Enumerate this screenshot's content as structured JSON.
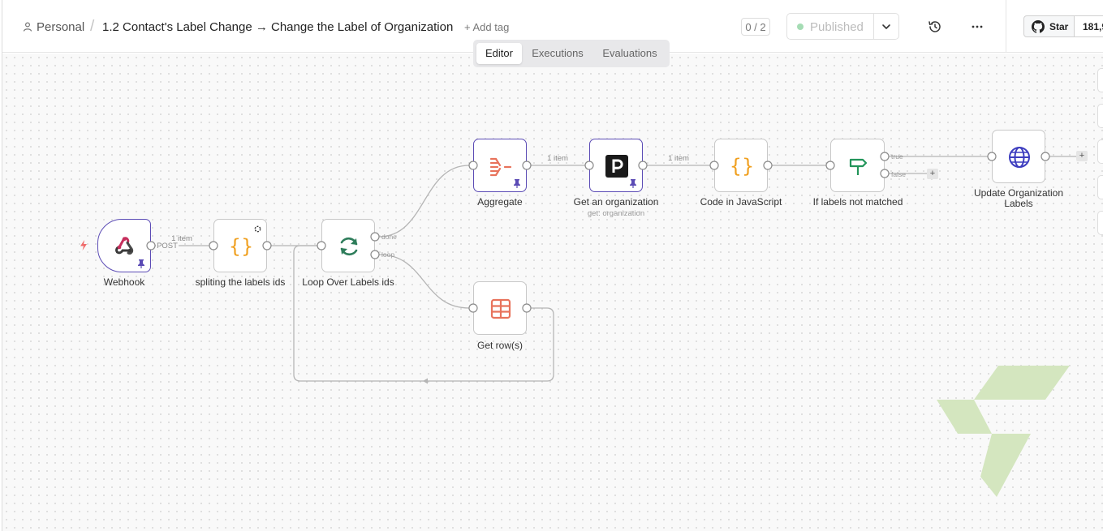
{
  "header": {
    "project": "Personal",
    "separator": "/",
    "workflow_name": "1.2 Contact's Label Change → Change the Label of Organization",
    "add_tag": "+ Add tag",
    "counter": "0 / 2",
    "status": "Published",
    "github": {
      "star_label": "Star",
      "star_count": "181,9"
    }
  },
  "tabs": [
    {
      "label": "Editor",
      "active": true
    },
    {
      "label": "Executions",
      "active": false
    },
    {
      "label": "Evaluations",
      "active": false
    }
  ],
  "nodes": {
    "webhook": {
      "label": "Webhook",
      "icon": "webhook-icon",
      "pinned": true
    },
    "split": {
      "label": "spliting the labels ids",
      "icon": "code-braces-icon"
    },
    "loop": {
      "label": "Loop Over Labels ids",
      "icon": "loop-icon",
      "outputs": [
        "done",
        "loop"
      ]
    },
    "aggregate": {
      "label": "Aggregate",
      "icon": "aggregate-icon",
      "pinned": true
    },
    "get_org": {
      "label": "Get an organization",
      "subtitle": "get: organization",
      "icon": "pipedrive-icon",
      "pinned": true
    },
    "code_js": {
      "label": "Code in JavaScript",
      "icon": "code-braces-icon"
    },
    "if_labels": {
      "label": "If labels not matched",
      "icon": "signpost-icon",
      "outputs": [
        "true",
        "false"
      ]
    },
    "update_org": {
      "label": "Update Organization Labels",
      "icon": "globe-icon"
    },
    "get_rows": {
      "label": "Get row(s)",
      "icon": "table-icon"
    }
  },
  "edges": {
    "webhook_split": {
      "method": "POST",
      "count": "1 item"
    },
    "aggregate_get_org": {
      "count": "1 item"
    },
    "get_org_code": {
      "count": "1 item"
    }
  },
  "colors": {
    "pinned_border": "#5b4bb5",
    "published_dot": "#a5dcb4",
    "code_icon": "#f0a020",
    "loop_icon": "#2e7d5b",
    "aggregate_icon": "#e8735c",
    "globe_icon": "#3d3dbf",
    "if_icon": "#22955a",
    "trigger_bolt": "#ef6b6b",
    "watermark": "#d4e6bf"
  }
}
